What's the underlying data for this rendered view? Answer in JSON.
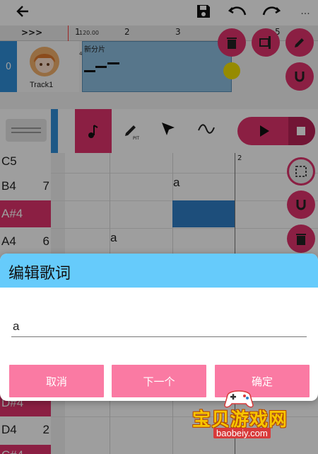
{
  "toolbar": {
    "back_icon": "arrow-left-icon",
    "save_icon": "floppy-disk-icon",
    "undo_icon": "undo-icon",
    "redo_icon": "redo-icon",
    "more_label": "..."
  },
  "track": {
    "expand_label": ">>>",
    "index": "0",
    "name": "Track1",
    "clip_name": "新分片",
    "tempo": "120.00",
    "time_signature": "4/4",
    "ruler_marks": [
      "1",
      "2",
      "3",
      "5"
    ]
  },
  "tools": {
    "items": [
      "note-icon",
      "pencil-pit-icon",
      "cursor-icon",
      "wave-icon"
    ],
    "pencil_sub": "PIT"
  },
  "transport": {
    "play_icon": "play-icon",
    "stop_icon": "stop-icon"
  },
  "piano": {
    "keys": [
      {
        "name": "C5",
        "num": ""
      },
      {
        "name": "B4",
        "num": "7"
      },
      {
        "name": "A#4",
        "num": ""
      },
      {
        "name": "A4",
        "num": "6"
      },
      {
        "name": "D#4",
        "num": ""
      },
      {
        "name": "D4",
        "num": "2"
      },
      {
        "name": "C#4",
        "num": ""
      }
    ],
    "bar_label": "2",
    "note_lyrics": [
      "a",
      "a"
    ]
  },
  "dialog": {
    "title": "编辑歌词",
    "input_value": "a",
    "cancel_label": "取消",
    "next_label": "下一个",
    "ok_label": "确定"
  },
  "watermark": {
    "title": "宝贝游戏网",
    "url": "baobeiy.com"
  },
  "colors": {
    "accent": "#e0336c",
    "dialog_header": "#66cbfb",
    "dialog_button": "#fa7aa3",
    "clip": "#8dbfe0",
    "note_selected": "#2f7fc7"
  }
}
